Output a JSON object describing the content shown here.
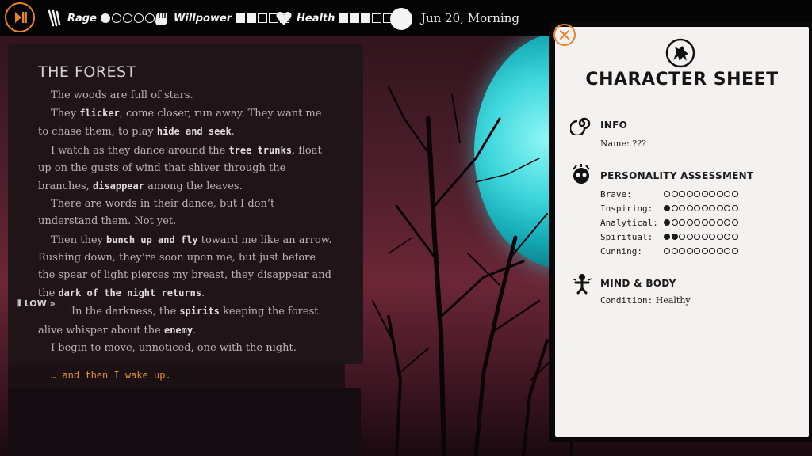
{
  "hud": {
    "rage": {
      "label": "Rage",
      "value": 1,
      "max": 5
    },
    "willpower": {
      "label": "Willpower",
      "value": 2,
      "max": 5
    },
    "health": {
      "label": "Health",
      "value": 3,
      "max": 5
    },
    "date": "Jun 20, Morning"
  },
  "story": {
    "title": "THE FOREST",
    "paragraphs": [
      [
        "The woods are full of stars."
      ],
      [
        "They ",
        {
          "kw": "flicker"
        },
        ", come closer, run away. They want me to chase them, to play ",
        {
          "kw": "hide and seek"
        },
        "."
      ],
      [
        "I watch as they dance around the ",
        {
          "kw": "tree trunks"
        },
        ", float up on the gusts of wind that shiver through the branches, ",
        {
          "kw": "disappear"
        },
        " among the leaves."
      ],
      [
        "There are words in their dance, but I don’t understand them. Not yet."
      ],
      [
        "Then they ",
        {
          "kw": "bunch up and fly"
        },
        " toward me like an arrow. Rushing down, they’re soon upon me, but just before the spear of light pierces my breast, they disappear and the ",
        {
          "kw": "dark of the night returns"
        },
        "."
      ],
      [
        "In the darkness, the ",
        {
          "kw": "spirits"
        },
        " keeping the forest alive whisper about the ",
        {
          "kw": "enemy"
        },
        "."
      ],
      [
        "I begin to move, unnoticed, one with the night."
      ]
    ],
    "volume_tag": "LOW",
    "continue_label": "… and then I wake up."
  },
  "sheet": {
    "title": "CHARACTER SHEET",
    "info": {
      "heading": "INFO",
      "name_label": "Name:",
      "name_value": "???"
    },
    "personality": {
      "heading": "PERSONALITY ASSESSMENT",
      "traits": [
        {
          "name": "Brave:",
          "value": 0,
          "max": 10
        },
        {
          "name": "Inspiring:",
          "value": 1,
          "max": 10
        },
        {
          "name": "Analytical:",
          "value": 1,
          "max": 10
        },
        {
          "name": "Spiritual:",
          "value": 2,
          "max": 10
        },
        {
          "name": "Cunning:",
          "value": 0,
          "max": 10
        }
      ]
    },
    "mind_body": {
      "heading": "MIND & BODY",
      "condition_label": "Condition:",
      "condition_value": "Healthy"
    }
  },
  "colors": {
    "accent": "#e8822b",
    "paper": "#f4f2f1",
    "panel": "#1f1418",
    "moon": "#3fd7dc"
  }
}
